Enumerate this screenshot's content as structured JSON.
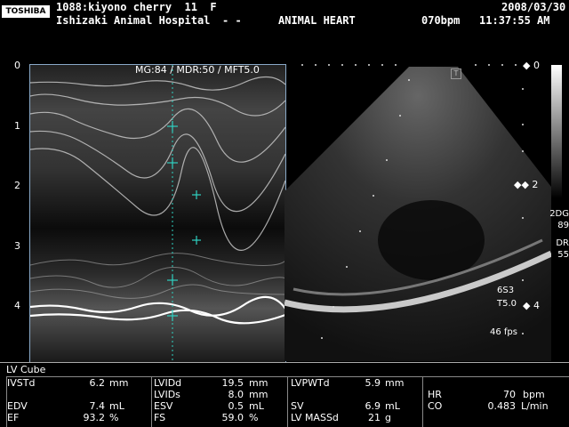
{
  "header": {
    "logo": "TOSHIBA",
    "patient": "1088:kiyono cherry  11  F",
    "hospital": "Ishizaki Animal Hospital",
    "dashes": "- -",
    "exam": "ANIMAL HEART",
    "date": "2008/03/30",
    "bpm_time": "070bpm   11:37:55 AM"
  },
  "mmode": {
    "params": "MG:84 / MDR:50 / MFT5.0",
    "depth_ticks": [
      "0",
      "1",
      "2",
      "3",
      "4"
    ]
  },
  "sector": {
    "marker_icon": "probe-orientation-icon",
    "depth_ticks": [
      "0",
      "2",
      "4"
    ],
    "settings": {
      "mode": "2DG",
      "gain": "89",
      "dr_label": "DR",
      "dr_value": "55",
      "probe": "6S3",
      "freq": "T5.0",
      "fps": "46 fps"
    }
  },
  "measurements": {
    "title": "LV Cube",
    "rows": [
      [
        {
          "label": "IVSTd",
          "value": "6.2",
          "unit": "mm"
        },
        {
          "label": "LVIDd",
          "value": "19.5",
          "unit": "mm"
        },
        {
          "label": "LVPWTd",
          "value": "5.9",
          "unit": "mm"
        }
      ],
      [
        {
          "label": "",
          "value": "",
          "unit": ""
        },
        {
          "label": "LVIDs",
          "value": "8.0",
          "unit": "mm"
        },
        {
          "label": "",
          "value": "",
          "unit": ""
        }
      ],
      [
        {
          "label": "EDV",
          "value": "7.4",
          "unit": "mL"
        },
        {
          "label": "ESV",
          "value": "0.5",
          "unit": "mL"
        },
        {
          "label": "SV",
          "value": "6.9",
          "unit": "mL"
        }
      ],
      [
        {
          "label": "EF",
          "value": "93.2",
          "unit": "%"
        },
        {
          "label": "FS",
          "value": "59.0",
          "unit": "%"
        },
        {
          "label": "LV MASSd",
          "value": "21",
          "unit": "g"
        }
      ]
    ],
    "extra": [
      {
        "label": "HR",
        "value": "70",
        "unit": "bpm"
      },
      {
        "label": "CO",
        "value": "0.483",
        "unit": "L/min"
      }
    ]
  },
  "colors": {
    "frame": "#89a9c8",
    "cursor": "#2fd2c2"
  }
}
